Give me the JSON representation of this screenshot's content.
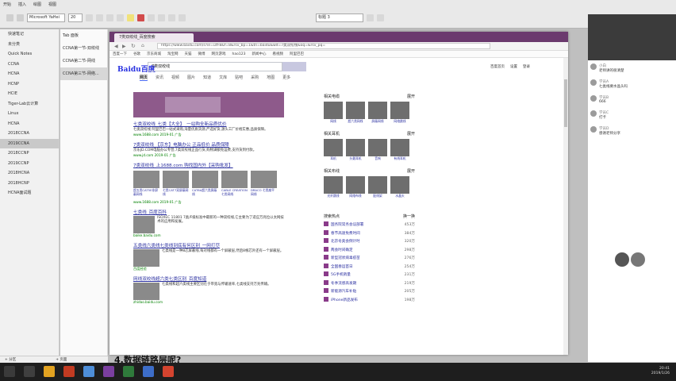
{
  "ribbon": {
    "tabs": [
      "开始",
      "插入",
      "绘图",
      "视图"
    ],
    "font_name": "Microsoft YaHei",
    "font_size": "20",
    "style_box": "标题 3"
  },
  "notebooks": [
    "快速笔记",
    "未分类",
    "Quick Notes",
    "CCNA",
    "HCNA",
    "HCNP",
    "HCIE",
    "Tiger-Lab云计算",
    "Linux",
    "HCNA",
    "2018CCNA",
    "2019CCNA",
    "2018CCNP",
    "2019CCNP",
    "2018HCNA",
    "2018HCNP",
    "HCNA面试题"
  ],
  "sections": [
    "Tab 面板",
    "CCNA第一节-双绞线",
    "CCNA第二节-网线",
    "CCNA第三节-网络..."
  ],
  "page_bar": {
    "add_section": "+ 分区",
    "add_page": "+ 页面"
  },
  "browser": {
    "tab_title": "7类双绞线_百度搜索",
    "url": "https://www.baidu.com/s?ie=utf-8&f=8&rsv_bp=1&tn=baidu&wd=7类双绞线&oq=&rsv_pq=",
    "bookmarks": [
      "百度一下",
      "谷歌",
      "京东商城",
      "淘宝网",
      "天猫",
      "微博",
      "网页游戏",
      "hao123",
      "新闻中心",
      "看视频",
      "阿里巴巴"
    ],
    "logo": "Baidu百度",
    "query": "7类双绞线",
    "top_links": [
      "百度首页",
      "设置",
      "登录"
    ],
    "search_tabs": [
      "网页",
      "资讯",
      "视频",
      "图片",
      "知道",
      "文库",
      "贴吧",
      "采购",
      "地图",
      "更多"
    ],
    "results": [
      {
        "title": "七类双绞线_七类【大全】_一站购全新品质优价",
        "desc": "七类双绞线 阿里巴巴一站式采购,海量优质货源,严选好货,源头工厂价格实惠,品质保障。",
        "url": "www.1688.com 2019-01 广告"
      },
      {
        "title": "7类双绞线 【京东】电脑办公 正品低价 品质保障",
        "desc": "京东JD.COM电脑办公专营,7类双绞线正品行货,购物满额免运费,支持货到付款。",
        "url": "www.jd.com 2019-01 广告"
      },
      {
        "title": "7类双绞线_上1688.com 购找国内外【采购批发】",
        "desc": "1688批发网提供7类双绞线产品大全,厂家直销批发价格,采购首选。",
        "url": "www.1688.com 2019-01 广告"
      },
      {
        "title": "七类线_百度百科",
        "desc": "ISO/IEC 11801 7类/F级标准中最新的一种双绞线,它主要为了适应万兆位以太网技术的应用和发展。",
        "url": "baike.baidu.com"
      },
      {
        "title": "五类线六类线七类线到底有何区别_一网打尽",
        "desc": "七类线是一种8芯屏蔽线,每对线都有一个屏蔽层,然后8根芯外还有一个屏蔽层。",
        "url": "百度经验"
      },
      {
        "title": "网线双绞线超六类七类区别_百度知道",
        "desc": "七类线和超六类线主要区别在于带宽与传输速率,七类线支持万兆传输。",
        "url": "zhidao.baidu.com"
      }
    ],
    "product_captions": [
      "超五类CAT5E非屏蔽网线",
      "七类CAT7双屏蔽网线",
      "CAT6A超六类屏蔽线",
      "CABLE CREATION七类网线",
      "DRACO 七类扁平网线"
    ],
    "right": {
      "sections": [
        {
          "title": "相关电缆",
          "more": "展开",
          "items": [
            "网线",
            "超六类网线",
            "屏蔽网线",
            "网络跳线"
          ]
        },
        {
          "title": "相关耳机",
          "more": "展开",
          "items": [
            "耳机",
            "头戴耳机",
            "音响",
            "有线耳机"
          ]
        },
        {
          "title": "相关布线",
          "more": "展开",
          "items": [
            "光纤跳线",
            "网络布线",
            "配线架",
            "水晶头"
          ]
        }
      ],
      "hot_title": "搜索热点",
      "hot_more": "换一换",
      "hot": [
        {
          "t": "国务院常务会议部署",
          "v": "453万"
        },
        {
          "t": "春节高速免费时间",
          "v": "384万"
        },
        {
          "t": "北京冬奥会倒计时",
          "v": "320万"
        },
        {
          "t": "两会时间确定",
          "v": "298万"
        },
        {
          "t": "新型冠状病毒疫苗",
          "v": "276万"
        },
        {
          "t": "全国春运首日",
          "v": "254万"
        },
        {
          "t": "5G手机销量",
          "v": "231万"
        },
        {
          "t": "冬季流感高发期",
          "v": "219万"
        },
        {
          "t": "新能源汽车补贴",
          "v": "205万"
        },
        {
          "t": "iPhone新品发布",
          "v": "198万"
        }
      ]
    }
  },
  "chat": [
    {
      "name": "小白",
      "text": "老师讲的很清楚"
    },
    {
      "name": "学员A",
      "text": "七类线要水晶头吗"
    },
    {
      "name": "学员B",
      "text": "666"
    },
    {
      "name": "学员C",
      "text": "打卡"
    },
    {
      "name": "学员D",
      "text": "感谢老师分享"
    }
  ],
  "heading": "4.数据链路层呢?",
  "clock": {
    "time": "20:41",
    "date": "2019/1/26"
  }
}
